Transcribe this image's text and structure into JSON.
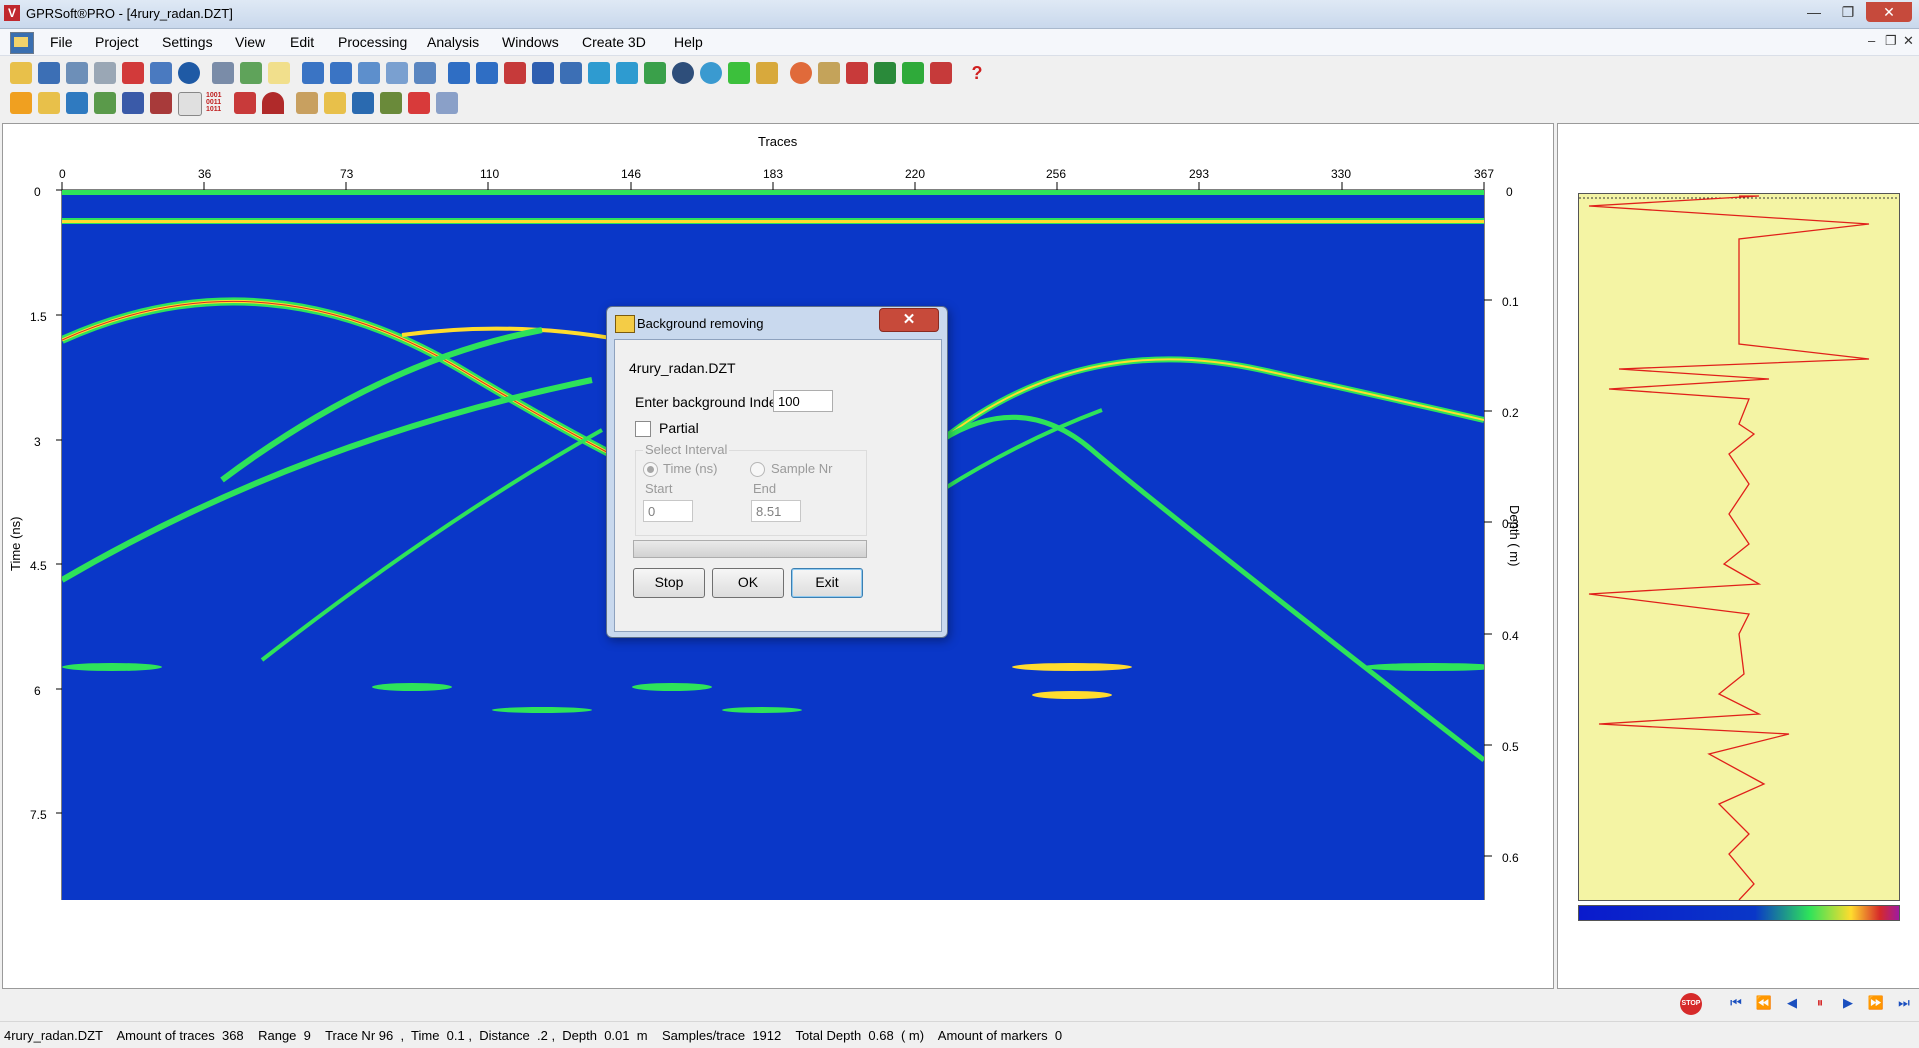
{
  "window": {
    "title": "GPRSoft®PRO - [4rury_radan.DZT]",
    "app_icon": "V"
  },
  "window_controls": {
    "minimize": "—",
    "maximize": "❐",
    "close": "✕"
  },
  "menu": {
    "items": [
      "File",
      "Project",
      "Settings",
      "View",
      "Edit",
      "Processing",
      "Analysis",
      "Windows",
      "Create 3D",
      "Help"
    ],
    "mdi_controls": [
      "–",
      "❐",
      "✕"
    ]
  },
  "toolbar1_icons": [
    "open-icon",
    "save-icon",
    "save-as-icon",
    "print-icon",
    "pdf-icon",
    "camera-icon",
    "globe-icon",
    "scissors-settings-icon",
    "check-icon",
    "notes-icon",
    "view1-icon",
    "view2-icon",
    "view3-icon",
    "grid-icon",
    "people-icon",
    "undo-icon",
    "redo-icon",
    "curve-icon",
    "numbers-icon",
    "cut-icon",
    "window-icon",
    "window2-icon",
    "arrows-icon",
    "clock-icon",
    "refresh-icon",
    "grid-green-icon",
    "magic-icon",
    "palette-icon",
    "zoom-icon",
    "marker-icon",
    "layers-icon",
    "mountain-icon",
    "flag-icon",
    "help-icon"
  ],
  "toolbar1_help": "?",
  "toolbar2_icons": [
    "filter-icon",
    "chart-icon",
    "migrate-icon",
    "gain-icon",
    "cross-icon",
    "antenna-icon",
    "hyperbola-icon",
    "binary-icon",
    "filter2-icon",
    "hyperbola2-icon",
    "crop-icon",
    "mountain2-icon",
    "branch-icon",
    "stack-icon",
    "shapes-icon",
    "monitor-icon"
  ],
  "toolbar2_binary": "1001\n0011\n1011",
  "radargram": {
    "top_axis_title": "Traces",
    "top_ticks": [
      "0",
      "36",
      "73",
      "110",
      "146",
      "183",
      "220",
      "256",
      "293",
      "330",
      "367"
    ],
    "left_axis_title": "Time (ns)",
    "left_ticks": [
      "0",
      "1.5",
      "3",
      "4.5",
      "6",
      "7.5"
    ],
    "right_axis_title": "Depth ( m)",
    "right_ticks": [
      "0",
      "0.1",
      "0.2",
      "0.3",
      "0.4",
      "0.5",
      "0.6"
    ],
    "colors": {
      "background": "#0a37c8",
      "primary_reflection": "#ffdc2e",
      "secondary": "#2ee35a",
      "peak": "#d62a2a"
    }
  },
  "dialog": {
    "title": "Background removing",
    "filename": "4rury_radan.DZT",
    "index_label": "Enter background Index",
    "index_value": "100",
    "partial_label": "Partial",
    "group_label": "Select Interval",
    "radio_time": "Time (ns)",
    "radio_sample": "Sample Nr",
    "start_label": "Start",
    "start_value": "0",
    "end_label": "End",
    "end_value": "8.51",
    "btn_stop": "Stop",
    "btn_ok": "OK",
    "btn_exit": "Exit",
    "close": "✕"
  },
  "status": {
    "text": "4rury_radan.DZT    Amount of traces  368    Range  9    Trace Nr 96  ,  Time  0.1 ,  Distance  .2 ,  Depth  0.01  m    Samples/trace  1912    Total Depth  0.68  ( m)    Amount of markers  0"
  },
  "nav": {
    "stop": "STOP",
    "buttons": [
      "⏮",
      "⏪",
      "◀",
      "⏸",
      "▶",
      "⏩",
      "⏭"
    ]
  }
}
